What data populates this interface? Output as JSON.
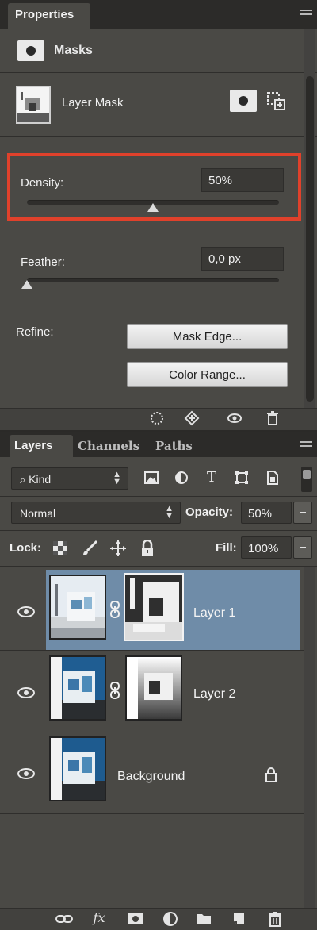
{
  "properties": {
    "tab_label": "Properties",
    "section_label": "Masks",
    "layer_mask_label": "Layer Mask",
    "density_label": "Density:",
    "density_value": "50%",
    "density_level": 0.5,
    "feather_label": "Feather:",
    "feather_value": "0,0 px",
    "feather_level": 0.0,
    "refine_label": "Refine:",
    "mask_edge_button": "Mask Edge...",
    "color_range_button": "Color Range...",
    "highlight_color": "#e0412b",
    "footer_icons": [
      "load-selection-icon",
      "apply-mask-icon",
      "disable-mask-icon",
      "delete-mask-icon"
    ]
  },
  "layers": {
    "tabs": [
      "Layers",
      "Channels",
      "Paths"
    ],
    "kind_label": "Kind",
    "filter_icons": [
      "pixel-filter-icon",
      "adjustment-filter-icon",
      "type-filter-icon",
      "shape-filter-icon",
      "smart-object-filter-icon"
    ],
    "blend_mode": "Normal",
    "opacity_label": "Opacity:",
    "opacity_value": "50%",
    "lock_label": "Lock:",
    "fill_label": "Fill:",
    "fill_value": "100%",
    "selected_color": "#6f8ca8",
    "items": [
      {
        "name": "Layer 1",
        "has_mask": true,
        "selected": true
      },
      {
        "name": "Layer 2",
        "has_mask": true,
        "selected": false
      },
      {
        "name": "Background",
        "has_mask": false,
        "locked": true
      }
    ],
    "bottom_icons": [
      "link-layers-icon",
      "fx-icon",
      "add-mask-icon",
      "adjustment-layer-icon",
      "new-group-icon",
      "new-layer-icon",
      "delete-layer-icon"
    ]
  }
}
